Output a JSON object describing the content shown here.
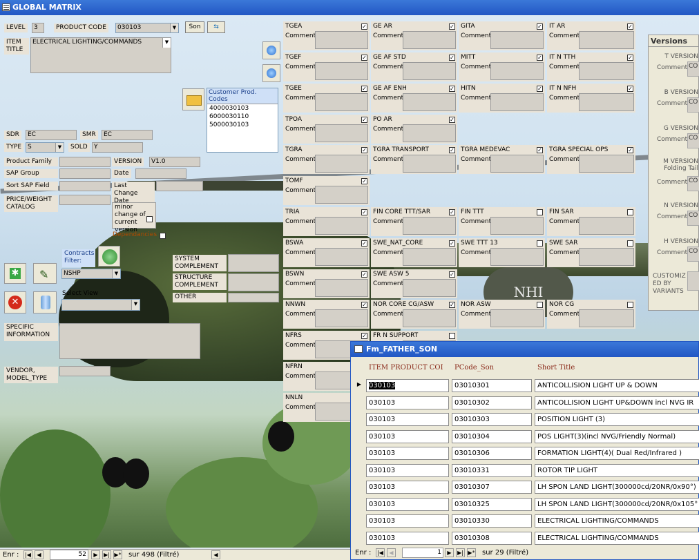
{
  "window": {
    "title": "GLOBAL MATRIX"
  },
  "header": {
    "level_label": "LEVEL",
    "level_value": "3",
    "product_code_label": "PRODUCT CODE",
    "product_code_value": "030103",
    "son_button": "Son",
    "item_title_label": "ITEM TITLE",
    "item_title_value": "ELECTRICAL LIGHTING/COMMANDS"
  },
  "customer_codes": {
    "label": "Customer Prod. Codes",
    "items": [
      "4000030103",
      "6000030110",
      "5000030103"
    ]
  },
  "left_fields": {
    "sdr_label": "SDR",
    "sdr_value": "EC",
    "smr_label": "SMR",
    "smr_value": "EC",
    "type_label": "TYPE",
    "type_value": "S",
    "sold_label": "SOLD",
    "sold_value": "Y",
    "product_family_label": "Product Family",
    "version_label": "VERSION",
    "version_value": "V1.0",
    "sap_group_label": "SAP Group",
    "date_label": "Date",
    "sort_sap_label": "Sort SAP Field",
    "last_change_label": "Last Change Date",
    "price_label": "PRICE/WEIGHT CATALOG",
    "minor_change_label": "minor change of current version",
    "dependancies_label": "Dependancies",
    "contracts_label": "Contracts Filter:",
    "contracts_value": "NSHP",
    "select_view_label": "Select View",
    "system_complement": "SYSTEM COMPLEMENT",
    "structure_complement": "STRUCTURE COMPLEMENT",
    "other_label": "OTHER",
    "specific_info_label": "SPECIFIC INFORMATION",
    "vendor_label": "VENDOR, MODEL_TYPE"
  },
  "comment_label": "Comment",
  "grid": [
    {
      "name": "TGEA",
      "checked": true
    },
    {
      "name": "GE AR",
      "checked": true
    },
    {
      "name": "GITA",
      "checked": true
    },
    {
      "name": "IT AR",
      "checked": true
    },
    {
      "name": "TGEF",
      "checked": true
    },
    {
      "name": "GE AF STD",
      "checked": true
    },
    {
      "name": "MITT",
      "checked": true
    },
    {
      "name": "IT N TTH",
      "checked": true
    },
    {
      "name": "TGEE",
      "checked": true
    },
    {
      "name": "GE AF ENH",
      "checked": true
    },
    {
      "name": "HITN",
      "checked": true
    },
    {
      "name": "IT N NFH",
      "checked": true
    },
    {
      "name": "TPOA",
      "checked": true
    },
    {
      "name": "PO AR",
      "checked": true
    },
    {
      "name": "TGRA",
      "checked": true
    },
    {
      "name": "TGRA TRANSPORT",
      "checked": true
    },
    {
      "name": "TGRA MEDEVAC",
      "checked": true
    },
    {
      "name": "TGRA SPECIAL OPS",
      "checked": true
    },
    {
      "name": "TOMF",
      "checked": true
    },
    {
      "name": "TRIA",
      "checked": true
    },
    {
      "name": "FIN CORE TTT/SAR",
      "checked": true
    },
    {
      "name": "FIN TTT",
      "checked": false
    },
    {
      "name": "FIN SAR",
      "checked": false
    },
    {
      "name": "BSWA",
      "checked": true
    },
    {
      "name": "SWE_NAT_CORE",
      "checked": true
    },
    {
      "name": "SWE TTT 13",
      "checked": false
    },
    {
      "name": "SWE SAR",
      "checked": false
    },
    {
      "name": "BSWN",
      "checked": true
    },
    {
      "name": "SWE ASW 5",
      "checked": true
    },
    {
      "name": "NNWN",
      "checked": true
    },
    {
      "name": "NOR CORE CG/ASW",
      "checked": true
    },
    {
      "name": "NOR ASW",
      "checked": false
    },
    {
      "name": "NOR CG",
      "checked": false
    },
    {
      "name": "NFRS",
      "checked": true
    },
    {
      "name": "FR N SUPPORT",
      "checked": false
    },
    {
      "name": "NFRN"
    },
    {
      "name": "NNLN"
    }
  ],
  "versions": {
    "title": "Versions",
    "items": [
      "T VERSION",
      "B VERSION",
      "G VERSION",
      "M VERSION Folding Tail",
      "N VERSION",
      "H VERSION"
    ],
    "value": "CO",
    "customized": "CUSTOMIZ ED BY VARIANTS"
  },
  "subform": {
    "title": "Fm_FATHER_SON",
    "columns": [
      "ITEM PRODUCT COI",
      "PCode_Son",
      "Short Title"
    ],
    "rows": [
      [
        "030103",
        "03010301",
        "ANTICOLLISION LIGHT UP & DOWN"
      ],
      [
        "030103",
        "03010302",
        "ANTICOLLISION LIGHT UP&DOWN incl NVG IR"
      ],
      [
        "030103",
        "03010303",
        "POSITION LIGHT (3)"
      ],
      [
        "030103",
        "03010304",
        "POS LIGHT(3)(incl NVG/Friendly Normal)"
      ],
      [
        "030103",
        "03010306",
        "FORMATION LIGHT(4)( Dual Red/Infrared )"
      ],
      [
        "030103",
        "03010331",
        "ROTOR TIP LIGHT"
      ],
      [
        "030103",
        "03010307",
        "LH SPON LAND LIGHT(300000cd/20NR/0x90°)"
      ],
      [
        "030103",
        "03010325",
        "LH SPON LAND LIGHT(300000cd/20NR/0x105°"
      ],
      [
        "030103",
        "03010330",
        "ELECTRICAL LIGHTING/COMMANDS"
      ],
      [
        "030103",
        "03010308",
        "ELECTRICAL LIGHTING/COMMANDS"
      ]
    ],
    "nav": {
      "label": "Enr :",
      "current": "1",
      "total": "sur 29 (Filtré)"
    }
  },
  "main_nav": {
    "label": "Enr :",
    "current": "52",
    "total": "sur 498 (Filtré)"
  }
}
